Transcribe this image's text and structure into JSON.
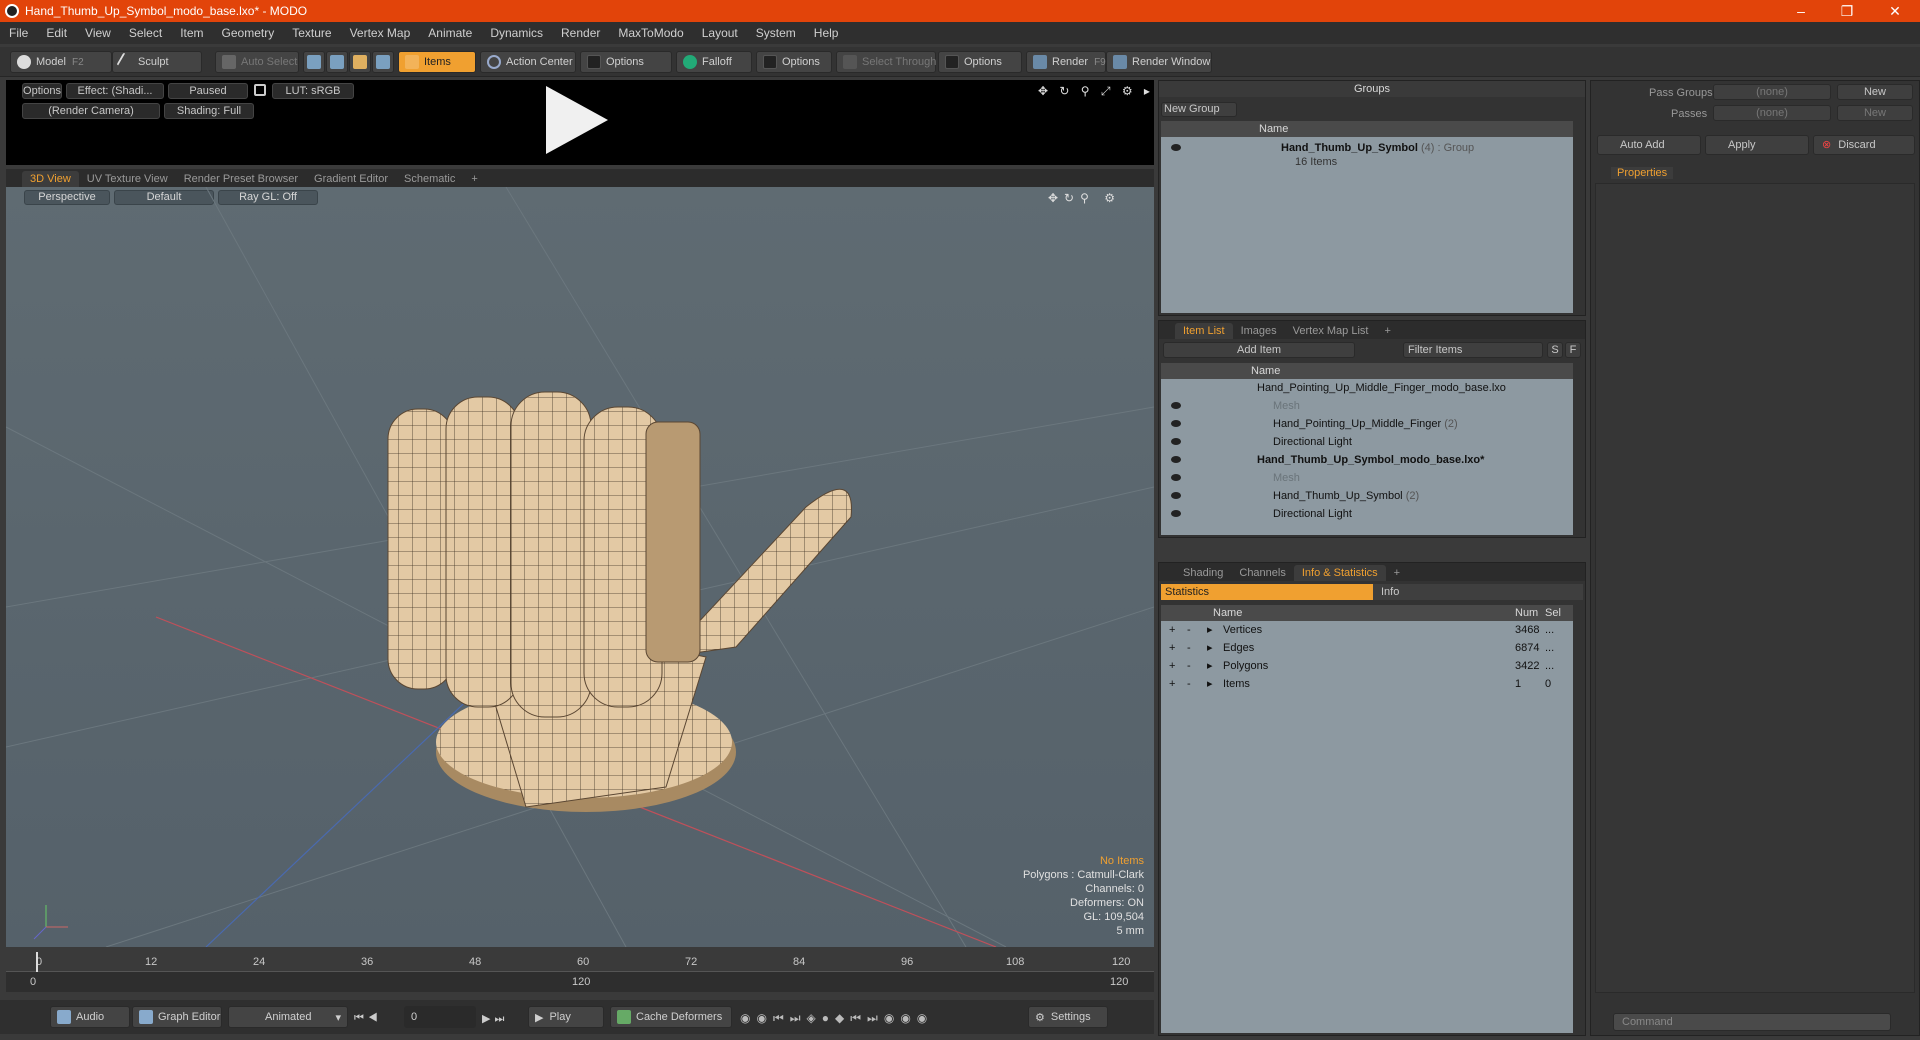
{
  "window": {
    "title": "Hand_Thumb_Up_Symbol_modo_base.lxo* - MODO",
    "minimize": "–",
    "restore": "❐",
    "close": "✕"
  },
  "menu": [
    "File",
    "Edit",
    "View",
    "Select",
    "Item",
    "Geometry",
    "Texture",
    "Vertex Map",
    "Animate",
    "Dynamics",
    "Render",
    "MaxToModo",
    "Layout",
    "System",
    "Help"
  ],
  "toolbar": {
    "model": "Model",
    "model_key": "F2",
    "sculpt": "Sculpt",
    "auto_select": "Auto Select",
    "items": "Items",
    "action_center": "Action Center",
    "options1": "Options",
    "falloff": "Falloff",
    "options2": "Options",
    "select_through": "Select Through",
    "options3": "Options",
    "render": "Render",
    "render_key": "F9",
    "render_window": "Render Window"
  },
  "preview": {
    "options": "Options",
    "effect": "Effect: (Shadi...",
    "paused": "Paused",
    "lut": "LUT: sRGB",
    "camera": "(Render Camera)",
    "shading": "Shading: Full"
  },
  "view_tabs": [
    "3D View",
    "UV Texture View",
    "Render Preset Browser",
    "Gradient Editor",
    "Schematic"
  ],
  "viewport": {
    "perspective": "Perspective",
    "default": "Default",
    "raygl": "Ray GL: Off",
    "info": {
      "no_items": "No Items",
      "polygons": "Polygons : Catmull-Clark",
      "channels": "Channels: 0",
      "deformers": "Deformers: ON",
      "gl": "GL: 109,504",
      "scale": "5 mm"
    }
  },
  "timeline": {
    "ticks": [
      "0",
      "12",
      "24",
      "36",
      "48",
      "60",
      "72",
      "84",
      "96",
      "108",
      "120"
    ],
    "range_start": "0",
    "range_mid": "120",
    "range_end": "120"
  },
  "bottombar": {
    "audio": "Audio",
    "graph_editor": "Graph Editor",
    "animated": "Animated",
    "frame": "0",
    "play": "Play",
    "cache_deformers": "Cache Deformers",
    "settings": "Settings"
  },
  "groups": {
    "title": "Groups",
    "new_group": "New Group",
    "col_name": "Name",
    "item_name": "Hand_Thumb_Up_Symbol",
    "item_count": "(4)",
    "item_type": ": Group",
    "item_sub": "16 Items"
  },
  "pass_groups": {
    "pass_groups_label": "Pass Groups",
    "pass_groups_value": "(none)",
    "new": "New",
    "passes_label": "Passes",
    "passes_value": "(none)",
    "new2": "New",
    "auto_add": "Auto Add",
    "apply": "Apply",
    "discard": "Discard",
    "properties_tab": "Properties"
  },
  "itemlist": {
    "tabs": [
      "Item List",
      "Images",
      "Vertex Map List"
    ],
    "add_item": "Add Item",
    "filter": "Filter Items",
    "s": "S",
    "f": "F",
    "col_name": "Name",
    "rows": [
      {
        "name": "Hand_Pointing_Up_Middle_Finger_modo_base.lxo",
        "count": ""
      },
      {
        "name": "Mesh",
        "count": ""
      },
      {
        "name": "Hand_Pointing_Up_Middle_Finger",
        "count": "(2)"
      },
      {
        "name": "Directional Light",
        "count": ""
      },
      {
        "name": "Hand_Thumb_Up_Symbol_modo_base.lxo*",
        "count": ""
      },
      {
        "name": "Mesh",
        "count": ""
      },
      {
        "name": "Hand_Thumb_Up_Symbol",
        "count": "(2)"
      },
      {
        "name": "Directional Light",
        "count": ""
      }
    ]
  },
  "stats": {
    "tabs": [
      "Shading",
      "Channels",
      "Info & Statistics"
    ],
    "sub_tabs": [
      "Statistics",
      "Info"
    ],
    "cols": {
      "name": "Name",
      "num": "Num",
      "sel": "Sel"
    },
    "rows": [
      {
        "name": "Vertices",
        "num": "3468",
        "sel": "..."
      },
      {
        "name": "Edges",
        "num": "6874",
        "sel": "..."
      },
      {
        "name": "Polygons",
        "num": "3422",
        "sel": "..."
      },
      {
        "name": "Items",
        "num": "1",
        "sel": "0"
      }
    ]
  },
  "command": {
    "placeholder": "Command"
  },
  "colors": {
    "accent": "#f0a030",
    "titlebar": "#e2440a"
  }
}
